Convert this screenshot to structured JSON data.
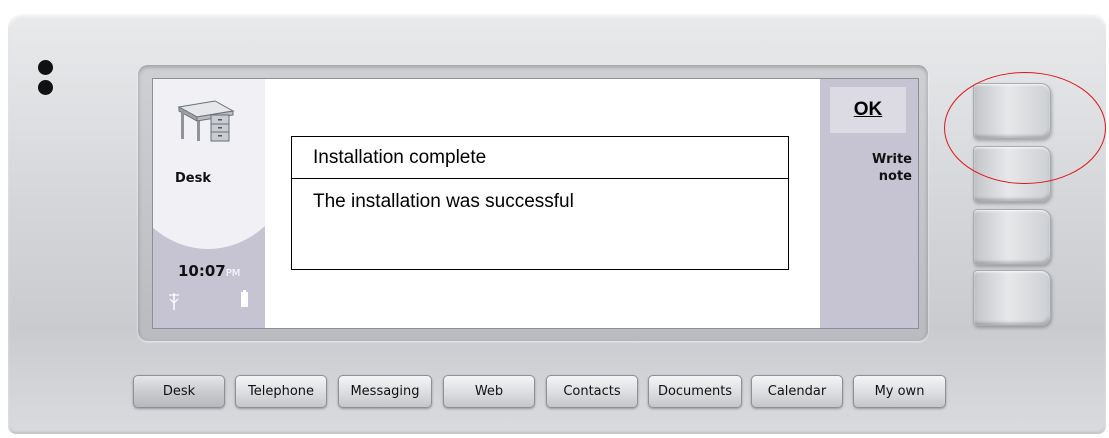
{
  "status": {
    "app_name": "Desk",
    "time": "10:07",
    "ampm": "PM",
    "signal_icon": "antenna-icon",
    "battery_icon": "battery-icon"
  },
  "dialog": {
    "title": "Installation complete",
    "message": "The installation was successful"
  },
  "commands": {
    "ok": "OK",
    "write_note_line1": "Write",
    "write_note_line2": "note"
  },
  "app_buttons": [
    "Desk",
    "Telephone",
    "Messaging",
    "Web",
    "Contacts",
    "Documents",
    "Calendar",
    "My own"
  ],
  "colors": {
    "highlight_ring": "#e0121a",
    "pane_lilac": "#c6c4d3"
  }
}
